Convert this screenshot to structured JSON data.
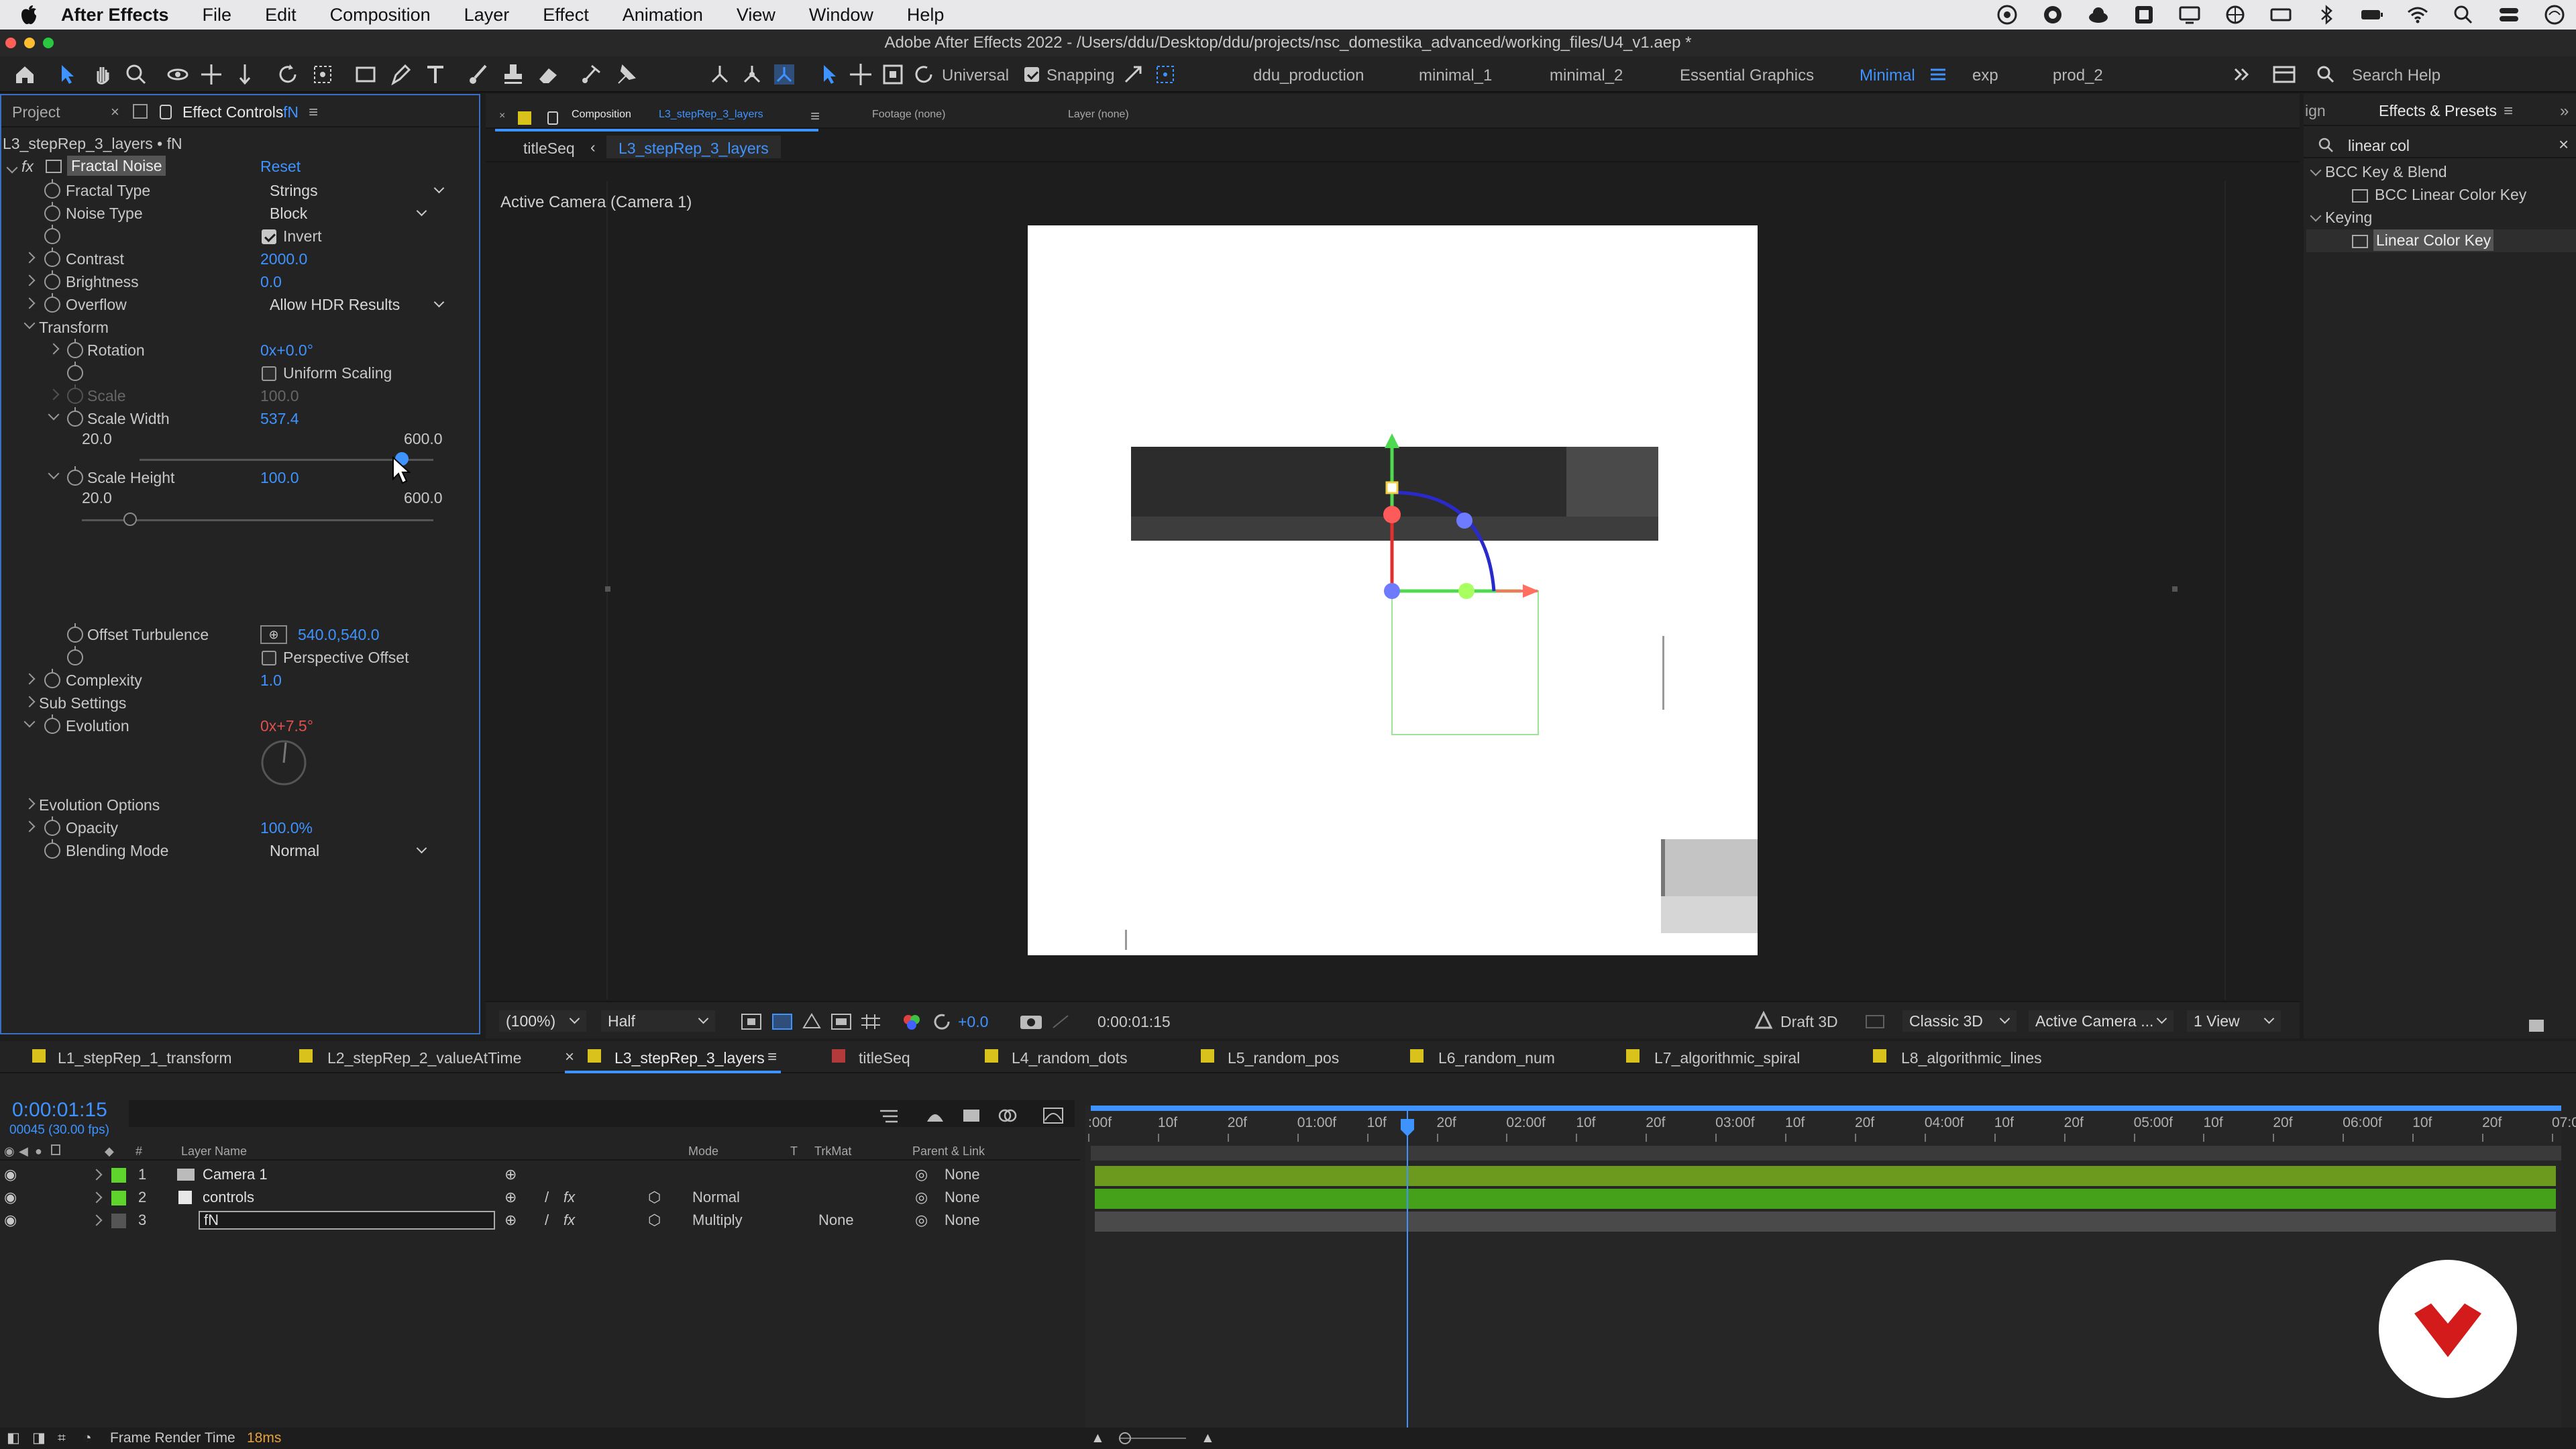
{
  "menubar": {
    "app": "After Effects",
    "items": [
      "File",
      "Edit",
      "Composition",
      "Layer",
      "Effect",
      "Animation",
      "View",
      "Window",
      "Help"
    ]
  },
  "titlebar": {
    "title": "Adobe After Effects 2022 - /Users/ddu/Desktop/ddu/projects/nsc_domestika_advanced/working_files/U4_v1.aep *"
  },
  "toolbar": {
    "universal_label": "Universal",
    "snapping_label": "Snapping",
    "workspaces": [
      "ddu_production",
      "minimal_1",
      "minimal_2",
      "Essential Graphics",
      "Minimal",
      "exp",
      "prod_2"
    ],
    "active_workspace": "Minimal",
    "search_placeholder": "Search Help"
  },
  "left_panel": {
    "tabs": {
      "project": "Project",
      "effect_controls": "Effect Controls",
      "effect_controls_layer": "fN"
    },
    "layer_path": "L3_stepRep_3_layers • fN",
    "fx_badge": "fx",
    "effect_name": "Fractal Noise",
    "reset": "Reset",
    "props": {
      "fractal_type": {
        "label": "Fractal Type",
        "value": "Strings"
      },
      "noise_type": {
        "label": "Noise Type",
        "value": "Block"
      },
      "invert": {
        "label": "Invert",
        "checked": true
      },
      "contrast": {
        "label": "Contrast",
        "value": "2000.0"
      },
      "brightness": {
        "label": "Brightness",
        "value": "0.0"
      },
      "overflow": {
        "label": "Overflow",
        "value": "Allow HDR Results"
      },
      "transform": {
        "label": "Transform"
      },
      "rotation": {
        "label": "Rotation",
        "value": "0x+0.0°"
      },
      "uniform_scaling": {
        "label": "Uniform Scaling",
        "checked": false
      },
      "scale": {
        "label": "Scale",
        "value": "100.0"
      },
      "scale_width": {
        "label": "Scale Width",
        "value": "537.4",
        "min": "20.0",
        "max": "600.0",
        "fraction": 0.893
      },
      "scale_height": {
        "label": "Scale Height",
        "value": "100.0",
        "min": "20.0",
        "max": "600.0",
        "fraction": 0.138
      },
      "offset_turbulence": {
        "label": "Offset Turbulence",
        "value": "540.0,540.0"
      },
      "perspective_offset": {
        "label": "Perspective Offset",
        "checked": false
      },
      "complexity": {
        "label": "Complexity",
        "value": "1.0"
      },
      "sub_settings": {
        "label": "Sub Settings"
      },
      "evolution": {
        "label": "Evolution",
        "value": "0x+7.5°"
      },
      "evolution_options": {
        "label": "Evolution Options"
      },
      "opacity": {
        "label": "Opacity",
        "value": "100.0%"
      },
      "blending_mode": {
        "label": "Blending Mode",
        "value": "Normal"
      }
    }
  },
  "comp_panel": {
    "tab_close": "×",
    "tab_label": "Composition",
    "tab_comp": "L3_stepRep_3_layers",
    "footage": "Footage (none)",
    "layer": "Layer (none)",
    "breadcrumb_parent": "titleSeq",
    "breadcrumb_current": "L3_stepRep_3_layers",
    "camera_label": "Active Camera (Camera 1)",
    "footer": {
      "zoom": "(100%)",
      "resolution": "Half",
      "exposure": "+0.0",
      "timecode": "0:00:01:15",
      "draft3d": "Draft 3D",
      "renderer": "Classic 3D",
      "view": "Active Camera ...",
      "layout": "1 View"
    }
  },
  "right_panel": {
    "tab_partial": "ign",
    "tab": "Effects & Presets",
    "search_value": "linear col",
    "groups": [
      {
        "name": "BCC Key & Blend",
        "items": [
          "BCC Linear Color Key"
        ]
      },
      {
        "name": "Keying",
        "items": [
          "Linear Color Key"
        ]
      }
    ]
  },
  "timeline": {
    "tabs": [
      {
        "label": "L1_stepRep_1_transform",
        "color": "#d9c21c"
      },
      {
        "label": "L2_stepRep_2_valueAtTime",
        "color": "#d9c21c"
      },
      {
        "label": "L3_stepRep_3_layers",
        "color": "#d9c21c"
      },
      {
        "label": "titleSeq",
        "color": "#b33a3a"
      },
      {
        "label": "L4_random_dots",
        "color": "#d9c21c"
      },
      {
        "label": "L5_random_pos",
        "color": "#d9c21c"
      },
      {
        "label": "L6_random_num",
        "color": "#d9c21c"
      },
      {
        "label": "L7_algorithmic_spiral",
        "color": "#d9c21c"
      },
      {
        "label": "L8_algorithmic_lines",
        "color": "#d9c21c"
      }
    ],
    "timecode": "0:00:01:15",
    "frames": "00045 (30.00 fps)",
    "columns": {
      "num": "#",
      "layer_name": "Layer Name",
      "mode": "Mode",
      "t": "T",
      "trkmat": "TrkMat",
      "parent": "Parent & Link"
    },
    "layers": [
      {
        "num": "1",
        "name": "Camera 1",
        "color": "#5fd42c",
        "mode": "",
        "trkmat": "",
        "parent": "None"
      },
      {
        "num": "2",
        "name": "controls",
        "color": "#e8e8e8",
        "mode": "Normal",
        "trkmat": "",
        "parent": "None"
      },
      {
        "num": "3",
        "name": "fN",
        "color": "#555555",
        "mode": "Multiply",
        "trkmat": "None",
        "parent": "None"
      }
    ],
    "ruler": [
      ":00f",
      "10f",
      "20f",
      "01:00f",
      "10f",
      "20f",
      "02:00f",
      "10f",
      "20f",
      "03:00f",
      "10f",
      "20f",
      "04:00f",
      "10f",
      "20f",
      "05:00f",
      "10f",
      "20f",
      "06:00f",
      "10f",
      "20f",
      "07:0"
    ]
  },
  "status": {
    "label": "Frame Render Time",
    "value": "18ms"
  }
}
